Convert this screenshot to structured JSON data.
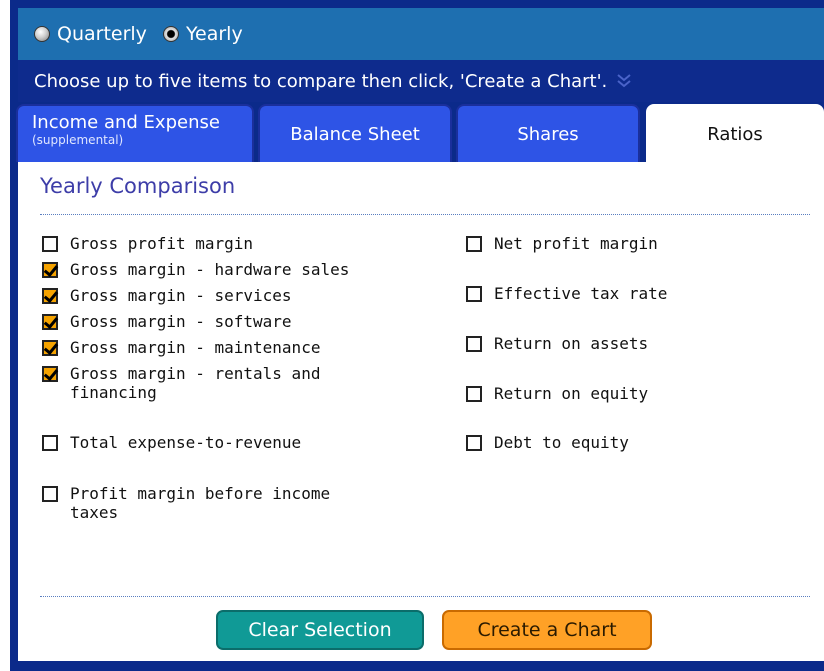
{
  "period_selector": {
    "options": [
      {
        "label": "Quarterly",
        "selected": false
      },
      {
        "label": "Yearly",
        "selected": true
      }
    ]
  },
  "instruction": "Choose up to five items to compare then click, 'Create a Chart'.",
  "tabs": [
    {
      "label": "Income and Expense",
      "sublabel": "(supplemental)",
      "active": false
    },
    {
      "label": "Balance Sheet",
      "active": false
    },
    {
      "label": "Shares",
      "active": false
    },
    {
      "label": "Ratios",
      "active": true
    }
  ],
  "panel": {
    "title": "Yearly Comparison",
    "left_items": [
      {
        "label": "Gross profit margin",
        "checked": false
      },
      {
        "label": "Gross margin - hardware sales",
        "checked": true
      },
      {
        "label": "Gross margin - services",
        "checked": true
      },
      {
        "label": "Gross margin - software",
        "checked": true
      },
      {
        "label": "Gross margin - maintenance",
        "checked": true
      },
      {
        "label": "Gross margin - rentals and\nfinancing",
        "checked": true
      },
      {
        "label": "Total expense-to-revenue",
        "checked": false
      },
      {
        "label": "Profit margin before income\ntaxes",
        "checked": false
      }
    ],
    "right_items": [
      {
        "label": "Net profit margin",
        "checked": false
      },
      {
        "label": "Effective tax rate",
        "checked": false
      },
      {
        "label": "Return on assets",
        "checked": false
      },
      {
        "label": "Return on equity",
        "checked": false
      },
      {
        "label": "Debt to equity",
        "checked": false
      }
    ]
  },
  "buttons": {
    "clear": "Clear Selection",
    "create": "Create a Chart"
  },
  "colors": {
    "frame": "#0b2a8a",
    "radio_bar": "#1e6fb0",
    "tab": "#2e54e6",
    "checked": "#f5a300",
    "clear_button": "#109a96",
    "create_button": "#ffa126",
    "title": "#3d3da8"
  }
}
